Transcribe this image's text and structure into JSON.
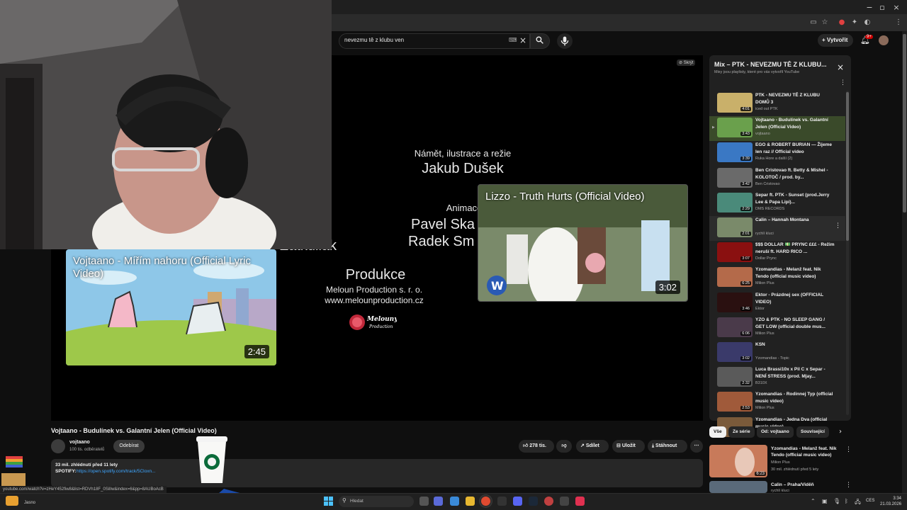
{
  "browser": {
    "window_controls": [
      "−",
      "▫",
      "×"
    ]
  },
  "header": {
    "search_value": "nevezmu tě z klubu ven",
    "create_label": "Vytvořit",
    "notification_count": "9+"
  },
  "player": {
    "subtitles_label": "Skrýt",
    "credits": {
      "role1": "Námět, ilustrace a režie",
      "name1": "Jakub Dušek",
      "role2": "Animace",
      "names2a": "Pavel Ska",
      "names2b": "Radek Sm",
      "partial": "Zatkuliak",
      "production": "Produkce",
      "company": "Meloun Production s. r. o.",
      "website": "www.melounproduction.cz",
      "logo_text": "Melouny Production"
    },
    "endcards": [
      {
        "title": "Vojtaano - Mířím nahoru (Official Lyric Video)",
        "duration": "2:45"
      },
      {
        "title": "Lizzo - Truth Hurts (Official Video)",
        "duration": "3:02"
      }
    ]
  },
  "video": {
    "title": "Vojtaano - Budulínek vs. Galantní Jelen (Official Video)",
    "channel": "vojtaano",
    "subscribers": "100 tis. odběratelů",
    "subscribe_label": "Odebírat",
    "likes": "278 tis.",
    "share_label": "Sdílet",
    "save_label": "Uložit",
    "download_label": "Stáhnout",
    "description_stats": "33 mil. zhlédnutí  před 11 lety",
    "spotify_label": "SPOTIFY:",
    "spotify_link": "https://open.spotify.com/track/5Cloxn..."
  },
  "status_url": "youtube.com/watch?v=zHeY452fiw8&list=RDVh18F_0SilIw&index=6&pp=8AUBoAcB",
  "playlist": {
    "title": "Mix – PTK - NEVEZMU TĚ Z KLUBU...",
    "subtitle": "Mixy jsou playlisty, které pro vás vytvořil YouTube",
    "items": [
      {
        "title": "PTK - NEVEZMU TĚ Z KLUBU DOMŮ 3",
        "channel": "iced out PTK",
        "duration": "4:01",
        "color": "#c9b06a"
      },
      {
        "title": "Vojtaano - Budulínek vs. Galantní Jelen (Official Video)",
        "channel": "vojtaano",
        "duration": "3:43",
        "color": "#6aa04c",
        "playing": true
      },
      {
        "title": "EGO & ROBERT BURIAN — Žijeme len raz // Official video",
        "channel": "Ruka Hore a další (2)",
        "duration": "3:39",
        "color": "#3a78c4"
      },
      {
        "title": "Ben Cristovao ft. Betty & Mishel - KOLOTOČ / prod. by...",
        "channel": "Ben Cristovao",
        "duration": "3:42",
        "color": "#6a6a6a"
      },
      {
        "title": "Separ ft. PTK - Sunset (prod.Jerry Lee & Papa Lipi)...",
        "channel": "DMS RECORDS",
        "duration": "2:29",
        "color": "#4a8a7a"
      },
      {
        "title": "Calin – Hannah Montana",
        "channel": "rychlí kluci",
        "duration": "2:01",
        "color": "#7a8a6a"
      },
      {
        "title": "$$$ DOLLAR 💵 PRYNC £££ - Režim neruší ft. HARD RICO ...",
        "channel": "Dollar Prync",
        "duration": "3:07",
        "color": "#8a1010"
      },
      {
        "title": "Yzomandias - Melanž feat. Nik Tendo (official music video)",
        "channel": "Milion Plus",
        "duration": "6:25",
        "color": "#b46a4a"
      },
      {
        "title": "Ektor - Prázdnej sex (OFFICIAL VIDEO)",
        "channel": "Ektor",
        "duration": "3:46",
        "color": "#2a1010"
      },
      {
        "title": "YZO & PTK - NO SLEEP GANG / GET LOW (official double mus...",
        "channel": "Milion Plus",
        "duration": "6:06",
        "color": "#4a3a4a"
      },
      {
        "title": "KSN",
        "channel": "Yzomandias - Topic",
        "duration": "3:02",
        "color": "#3a3a6a"
      },
      {
        "title": "Luca Brassi10x x Pil C x Separ - NENÍ STRESS (prod. Mjay...",
        "channel": "B310X",
        "duration": "2:32",
        "color": "#5a5a5a"
      },
      {
        "title": "Yzomandias - Rodinnej Typ (official music video)",
        "channel": "Milion Plus",
        "duration": "2:53",
        "color": "#a05a3a"
      },
      {
        "title": "Yzomandias - Jedna Dva (official music video)",
        "channel": "",
        "duration": "",
        "color": "#7a5a3a"
      }
    ]
  },
  "chips": [
    "Vše",
    "Ze série",
    "Od: vojtaano",
    "Související"
  ],
  "related": [
    {
      "title": "Yzomandias - Melanž feat. Nik Tendo (official music video)",
      "channel": "Milion Plus",
      "meta": "30 mil. zhlédnutí  před 5 lety",
      "duration": "6:23"
    },
    {
      "title": "Calin – Praha/Viděň",
      "channel": "rychlí kluci",
      "meta": "",
      "duration": ""
    }
  ],
  "taskbar": {
    "left_text": "Jasno",
    "search_placeholder": "Hledat",
    "lang": "CES",
    "time": "3:34",
    "date": "21.03.2026"
  },
  "colors": {
    "background": "#0f0f0f",
    "accent_red": "#cc0000",
    "link_blue": "#3ea6ff",
    "panel": "#212121"
  }
}
